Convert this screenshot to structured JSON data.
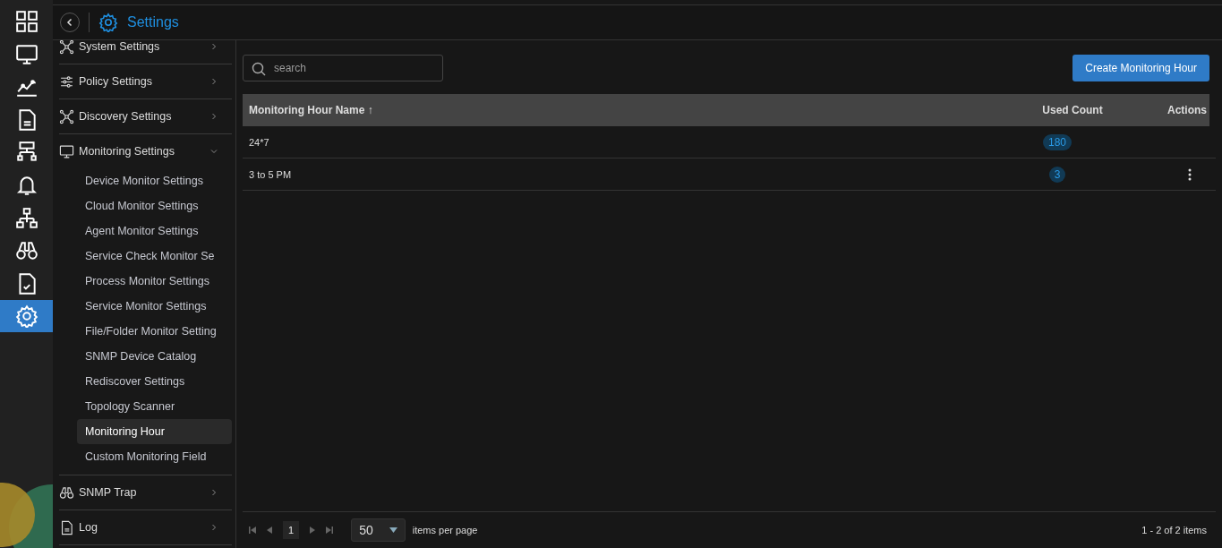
{
  "rail": [
    {
      "kind": "grid",
      "selected": false
    },
    {
      "kind": "monitor",
      "selected": false
    },
    {
      "kind": "chart",
      "selected": false
    },
    {
      "kind": "doc",
      "selected": false
    },
    {
      "kind": "network",
      "selected": false
    },
    {
      "kind": "bell",
      "selected": false
    },
    {
      "kind": "topology",
      "selected": false
    },
    {
      "kind": "binoculars",
      "selected": false
    },
    {
      "kind": "check",
      "selected": false
    },
    {
      "kind": "gear",
      "selected": true
    }
  ],
  "header": {
    "title": "Settings"
  },
  "sidebar": {
    "items": [
      {
        "label": "System Settings",
        "kind": "nodes",
        "expanded": false
      },
      {
        "label": "Policy Settings",
        "kind": "sliders",
        "expanded": false
      },
      {
        "label": "Discovery Settings",
        "kind": "nodes",
        "expanded": false
      },
      {
        "label": "Monitoring Settings",
        "kind": "monitor",
        "expanded": true,
        "children": [
          {
            "label": "Device Monitor Settings",
            "selected": false
          },
          {
            "label": "Cloud Monitor Settings",
            "selected": false
          },
          {
            "label": "Agent Monitor Settings",
            "selected": false
          },
          {
            "label": "Service Check Monitor Se",
            "selected": false
          },
          {
            "label": "Process Monitor Settings",
            "selected": false
          },
          {
            "label": "Service Monitor Settings",
            "selected": false
          },
          {
            "label": "File/Folder Monitor Setting",
            "selected": false
          },
          {
            "label": "SNMP Device Catalog",
            "selected": false
          },
          {
            "label": "Rediscover Settings",
            "selected": false
          },
          {
            "label": "Topology Scanner",
            "selected": false
          },
          {
            "label": "Monitoring Hour",
            "selected": true
          },
          {
            "label": "Custom Monitoring Field",
            "selected": false
          }
        ]
      },
      {
        "label": "SNMP Trap",
        "kind": "binoculars",
        "expanded": false
      },
      {
        "label": "Log",
        "kind": "doc",
        "expanded": false
      }
    ]
  },
  "search": {
    "placeholder": "search"
  },
  "create_button": "Create Monitoring Hour",
  "table": {
    "columns": [
      "Monitoring Hour Name ↑",
      "Used Count",
      "Actions"
    ],
    "rows": [
      {
        "name": "24*7",
        "used_count": "180",
        "has_actions": false
      },
      {
        "name": "3 to 5 PM",
        "used_count": "3",
        "has_actions": true
      }
    ]
  },
  "pager": {
    "page": "1",
    "per_page": "50",
    "per_page_label": "items per page",
    "summary": "1 - 2 of 2 items"
  }
}
